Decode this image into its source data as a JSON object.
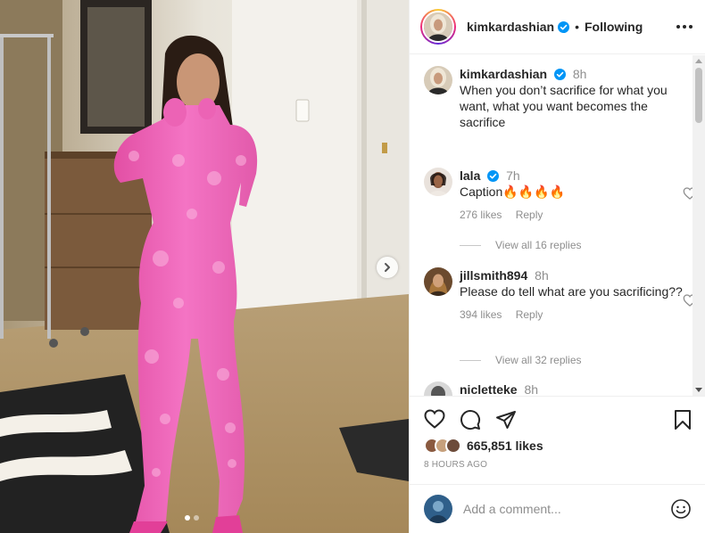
{
  "post": {
    "author": "kimkardashian",
    "follow_separator": "•",
    "follow_status": "Following",
    "carousel_total": 2,
    "carousel_active": 1
  },
  "caption": {
    "username": "kimkardashian",
    "time": "8h",
    "text": "When you don’t sacrifice for what you want, what you want becomes the sacrifice"
  },
  "comments": [
    {
      "username": "lala",
      "verified": true,
      "time": "7h",
      "text": "Caption🔥🔥🔥🔥",
      "likes": "276 likes",
      "reply_label": "Reply",
      "view_replies": "View all 16 replies"
    },
    {
      "username": "jillsmith894",
      "verified": false,
      "time": "8h",
      "text": "Please do tell what are you sacrificing??",
      "likes": "394 likes",
      "reply_label": "Reply",
      "view_replies": "View all 32 replies"
    },
    {
      "username": "nicletteke",
      "verified": false,
      "time": "8h"
    }
  ],
  "engagement": {
    "likes_count": "665,851 likes",
    "time_ago": "8 HOURS AGO"
  },
  "composer": {
    "placeholder": "Add a comment..."
  },
  "icons": {
    "like": "heart-icon",
    "comment": "comment-icon",
    "share": "paper-plane-icon",
    "save": "bookmark-icon",
    "emoji": "smiley-icon",
    "more": "ellipsis-icon",
    "next": "chevron-right-icon",
    "verified": "verified-badge-icon"
  },
  "colors": {
    "verified": "#0095f6",
    "text": "#262626",
    "secondary": "#8e8e8e",
    "outfit": "#f06ab8"
  }
}
